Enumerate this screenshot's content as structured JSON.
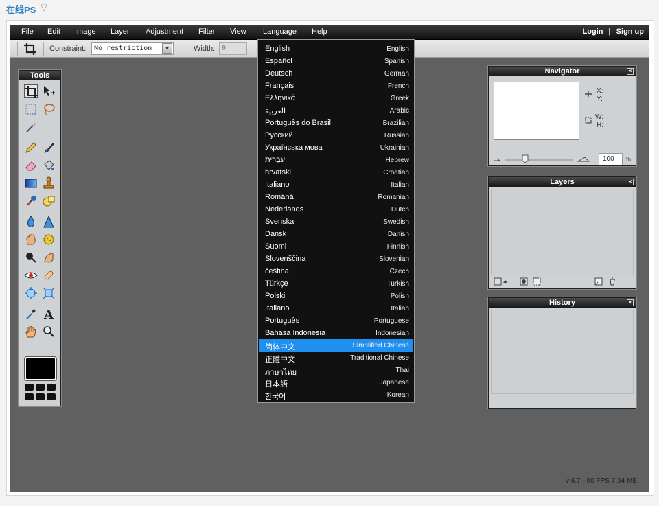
{
  "site": {
    "title": "在线PS",
    "caret": "▽"
  },
  "menubar": {
    "items": [
      "File",
      "Edit",
      "Image",
      "Layer",
      "Adjustment",
      "Filter",
      "View",
      "Language",
      "Help"
    ],
    "login": "Login",
    "separator": "|",
    "signup": "Sign up"
  },
  "options": {
    "constraint_label": "Constraint:",
    "constraint_value": "No restriction",
    "width_label": "Width:",
    "width_value": "0"
  },
  "tools_panel": {
    "title": "Tools"
  },
  "navigator": {
    "title": "Navigator",
    "x_label": "X:",
    "y_label": "Y:",
    "w_label": "W:",
    "h_label": "H:",
    "zoom": "100",
    "zoom_unit": "%",
    "zoom_level": 0.3
  },
  "layers": {
    "title": "Layers"
  },
  "history": {
    "title": "History"
  },
  "status": {
    "version": "v:6.7 - 60 FPS 7.94 MB"
  },
  "language_menu": {
    "selected_index": 24,
    "items": [
      {
        "native": "English",
        "english": "English"
      },
      {
        "native": "Español",
        "english": "Spanish"
      },
      {
        "native": "Deutsch",
        "english": "German"
      },
      {
        "native": "Français",
        "english": "French"
      },
      {
        "native": "Ελληνικά",
        "english": "Greek"
      },
      {
        "native": "العربية",
        "english": "Arabic"
      },
      {
        "native": "Português do Brasil",
        "english": "Brazilian"
      },
      {
        "native": "Русский",
        "english": "Russian"
      },
      {
        "native": "Українська мова",
        "english": "Ukrainian"
      },
      {
        "native": "עִבְרִית",
        "english": "Hebrew"
      },
      {
        "native": "hrvatski",
        "english": "Croatian"
      },
      {
        "native": "Italiano",
        "english": "Italian"
      },
      {
        "native": "Română",
        "english": "Romanian"
      },
      {
        "native": "Nederlands",
        "english": "Dutch"
      },
      {
        "native": "Svenska",
        "english": "Swedish"
      },
      {
        "native": "Dansk",
        "english": "Danish"
      },
      {
        "native": "Suomi",
        "english": "Finnish"
      },
      {
        "native": "Slovenščina",
        "english": "Slovenian"
      },
      {
        "native": "čeština",
        "english": "Czech"
      },
      {
        "native": "Türkçe",
        "english": "Turkish"
      },
      {
        "native": "Polski",
        "english": "Polish"
      },
      {
        "native": "Italiano",
        "english": "Italian"
      },
      {
        "native": "Português",
        "english": "Portuguese"
      },
      {
        "native": "Bahasa Indonesia",
        "english": "Indonesian"
      },
      {
        "native": "简体中文",
        "english": "Simplified Chinese"
      },
      {
        "native": "正體中文",
        "english": "Traditional Chinese"
      },
      {
        "native": "ภาษาไทย",
        "english": "Thai"
      },
      {
        "native": "日本語",
        "english": "Japanese"
      },
      {
        "native": "한국어",
        "english": "Korean"
      }
    ]
  },
  "tool_icons": [
    "crop-icon",
    "move-icon",
    "marquee-icon",
    "lasso-icon",
    "magic-wand-icon",
    "pencil-icon",
    "brush-icon",
    "eraser-icon",
    "bucket-icon",
    "gradient-icon",
    "stamp-icon",
    "replace-color-icon",
    "shapes-icon",
    "blur-icon",
    "sharpen-icon",
    "smudge-icon",
    "sponge-icon",
    "dodge-icon",
    "burn-icon",
    "red-eye-icon",
    "spot-heal-icon",
    "bloat-icon",
    "pinch-icon",
    "color-picker-icon",
    "type-icon",
    "hand-icon",
    "zoom-icon"
  ],
  "colors": {
    "accent": "#1f8ff0",
    "site_title": "#2a7fc4",
    "workspace": "#606060"
  }
}
